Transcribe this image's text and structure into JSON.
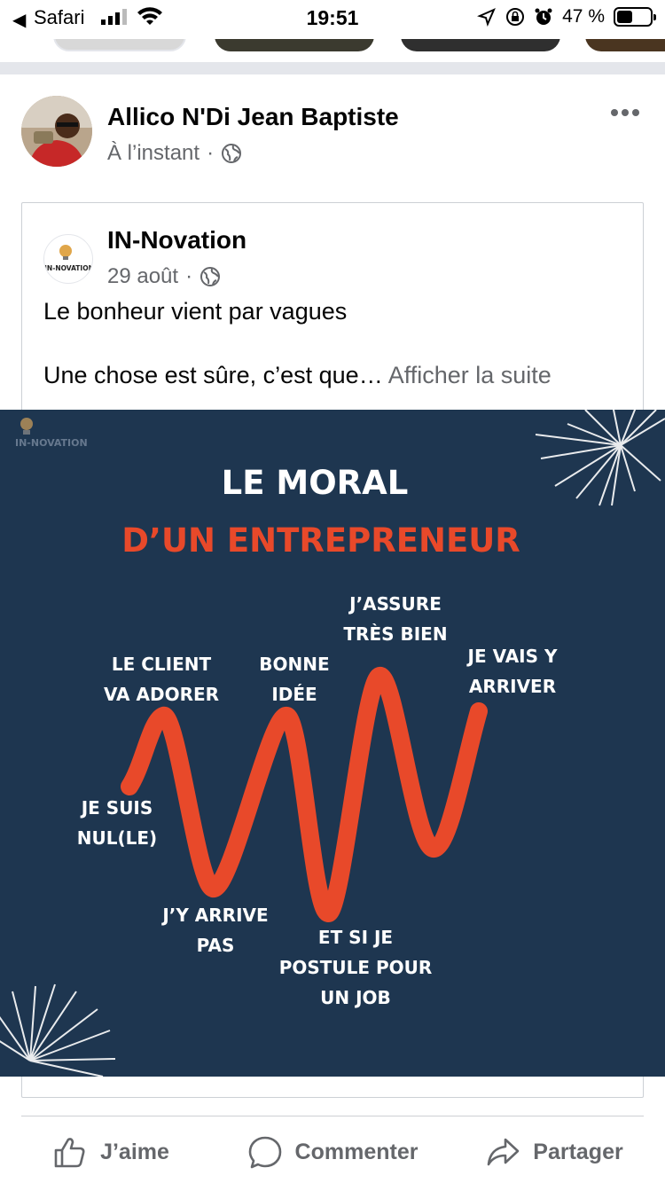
{
  "status_bar": {
    "carrier": "Safari",
    "time": "19:51",
    "battery_percent": "47 %",
    "battery_level": 0.47
  },
  "post": {
    "author": "Allico N'Di Jean Baptiste",
    "timestamp": "À l’instant",
    "separator": "·"
  },
  "shared": {
    "page_name": "IN-Novation",
    "page_logo_text": "IN-NOVATION",
    "date": "29 août",
    "separator": "·",
    "text_line1": "Le bonheur vient par vagues",
    "text_line2": "Une chose est sûre, c’est que…",
    "see_more": "Afficher la suite"
  },
  "image": {
    "logo_text": "IN-NOVATION",
    "title": "LE MORAL",
    "subtitle": "D’UN ENTREPRENEUR",
    "labels": {
      "je_suis_1": "JE SUIS",
      "je_suis_2": "NUL(LE)",
      "client_1": "LE CLIENT",
      "client_2": "VA ADORER",
      "arrive_1": "J’Y ARRIVE",
      "arrive_2": "PAS",
      "bonne_1": "BONNE",
      "bonne_2": "IDÉE",
      "etsi_1": "ET SI JE",
      "etsi_2": "POSTULE POUR",
      "etsi_3": "UN JOB",
      "assure_1": "J’ASSURE",
      "assure_2": "TRÈS BIEN",
      "vais_1": "JE VAIS Y",
      "vais_2": "ARRIVER"
    },
    "colors": {
      "background": "#1e3650",
      "accent": "#e8492a",
      "text": "#ffffff"
    }
  },
  "actions": {
    "like": "J’aime",
    "comment": "Commenter",
    "share": "Partager"
  }
}
